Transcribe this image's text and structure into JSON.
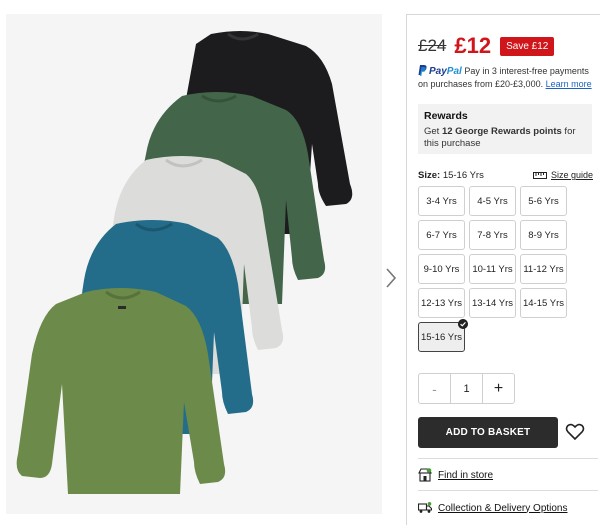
{
  "pricing": {
    "was": "£24",
    "now": "£12",
    "save_badge": "Save £12"
  },
  "paypal": {
    "logo_pay": "Pay",
    "logo_pal": "Pal",
    "text": "Pay in 3 interest-free payments on purchases from £20-£3,000.",
    "link": "Learn more"
  },
  "rewards": {
    "title": "Rewards",
    "text_prefix": "Get ",
    "points": "12 George Rewards points",
    "text_suffix": " for this purchase"
  },
  "size": {
    "label": "Size:",
    "selected": "15-16 Yrs",
    "guide_label": "Size guide",
    "options": [
      "3-4 Yrs",
      "4-5 Yrs",
      "5-6 Yrs",
      "6-7 Yrs",
      "7-8 Yrs",
      "8-9 Yrs",
      "9-10 Yrs",
      "10-11 Yrs",
      "11-12 Yrs",
      "12-13 Yrs",
      "13-14 Yrs",
      "14-15 Yrs",
      "15-16 Yrs"
    ]
  },
  "quantity": {
    "minus": "-",
    "value": "1",
    "plus": "+"
  },
  "actions": {
    "add_to_basket": "ADD TO BASKET"
  },
  "links": {
    "find_in_store": "Find in store",
    "collection_delivery": "Collection & Delivery Options"
  },
  "colors": {
    "price_red": "#d0161b",
    "button_dark": "#2c2c2c",
    "paypal_blue": "#1b3c8f",
    "paypal_light": "#1d8fd5",
    "shirt_black": "#1c1c1e",
    "shirt_dark_green": "#43654a",
    "shirt_grey": "#dcdcda",
    "shirt_teal": "#236d8a",
    "shirt_khaki": "#6c8a4a"
  },
  "icons": {
    "next": "chevron-right-icon",
    "wishlist": "heart-icon",
    "store": "store-icon",
    "delivery": "delivery-van-icon",
    "size_guide": "ruler-icon"
  }
}
